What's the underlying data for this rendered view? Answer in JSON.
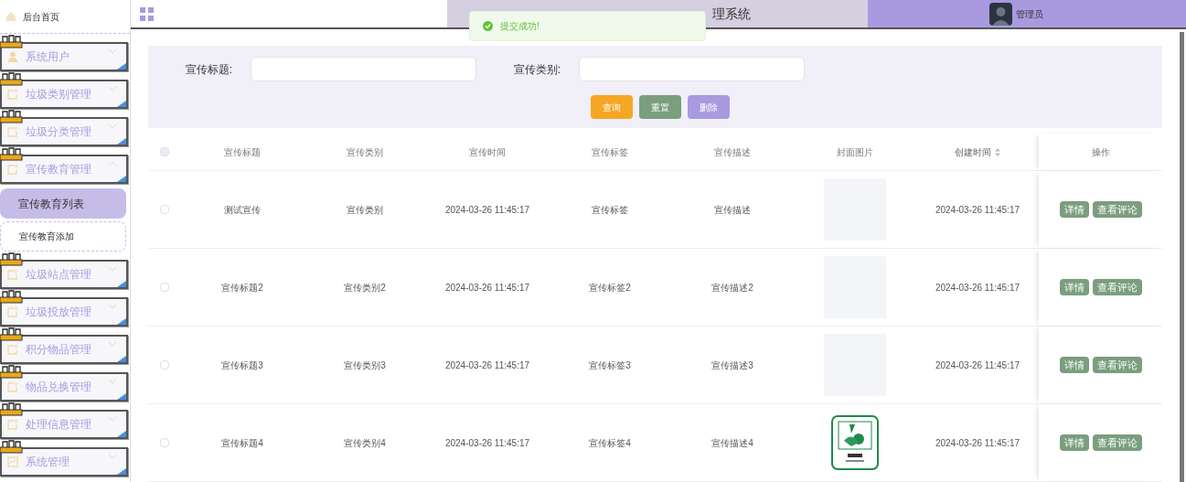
{
  "sidebar": {
    "home": {
      "label": "后台首页"
    },
    "menus": [
      {
        "label": "系统用户",
        "kind": "user",
        "expanded": false
      },
      {
        "label": "垃圾类别管理",
        "kind": "doc",
        "expanded": false
      },
      {
        "label": "垃圾分类管理",
        "kind": "doc",
        "expanded": false
      },
      {
        "label": "宣传教育管理",
        "kind": "doc",
        "expanded": true,
        "children": [
          {
            "label": "宣传教育列表",
            "selected": true
          },
          {
            "label": "宣传教育添加",
            "selected": false
          }
        ]
      },
      {
        "label": "垃圾站点管理",
        "kind": "doc",
        "expanded": false
      },
      {
        "label": "垃圾投放管理",
        "kind": "doc",
        "expanded": false
      },
      {
        "label": "积分物品管理",
        "kind": "doc",
        "expanded": false
      },
      {
        "label": "物品兑换管理",
        "kind": "doc",
        "expanded": false
      },
      {
        "label": "处理信息管理",
        "kind": "doc",
        "expanded": false
      },
      {
        "label": "系统管理",
        "kind": "chart",
        "expanded": false
      }
    ]
  },
  "header": {
    "title": "理系统",
    "user": "管理员"
  },
  "toast": {
    "message": "提交成功!"
  },
  "search": {
    "fields": [
      {
        "label": "宣传标题:"
      },
      {
        "label": "宣传类别:"
      }
    ],
    "buttons": [
      {
        "label": "查询",
        "color": "#f5a623"
      },
      {
        "label": "重置",
        "color": "#7a9e7e"
      },
      {
        "label": "删除",
        "color": "#a99ae0"
      }
    ]
  },
  "table": {
    "columns": [
      {
        "label": "宣传标题",
        "sortable": false
      },
      {
        "label": "宣传类别",
        "sortable": false
      },
      {
        "label": "宣传时间",
        "sortable": false
      },
      {
        "label": "宣传标签",
        "sortable": false
      },
      {
        "label": "宣传描述",
        "sortable": false
      },
      {
        "label": "封面图片",
        "sortable": false
      },
      {
        "label": "创建时间",
        "sortable": true
      },
      {
        "label": "操作",
        "sortable": false
      }
    ],
    "header_checked": false,
    "rows": [
      {
        "checked": false,
        "cells": [
          "测试宣传",
          "宣传类别",
          "2024-03-26 11:45:17",
          "宣传标签",
          "宣传描述"
        ],
        "cover": {
          "kind": "empty"
        },
        "created": "2024-03-26 11:45:17",
        "actions": [
          "详情",
          "查看评论"
        ]
      },
      {
        "checked": false,
        "cells": [
          "宣传标题2",
          "宣传类别2",
          "2024-03-26 11:45:17",
          "宣传标签2",
          "宣传描述2"
        ],
        "cover": {
          "kind": "empty"
        },
        "created": "2024-03-26 11:45:17",
        "actions": [
          "详情",
          "查看评论"
        ]
      },
      {
        "checked": false,
        "cells": [
          "宣传标题3",
          "宣传类别3",
          "2024-03-26 11:45:17",
          "宣传标签3",
          "宣传描述3"
        ],
        "cover": {
          "kind": "empty"
        },
        "created": "2024-03-26 11:45:17",
        "actions": [
          "详情",
          "查看评论"
        ]
      },
      {
        "checked": false,
        "cells": [
          "宣传标题4",
          "宣传类别4",
          "2024-03-26 11:45:17",
          "宣传标签4",
          "宣传描述4"
        ],
        "cover": {
          "kind": "picture"
        },
        "created": "2024-03-26 11:45:17",
        "actions": [
          "详情",
          "查看评论"
        ]
      }
    ]
  }
}
